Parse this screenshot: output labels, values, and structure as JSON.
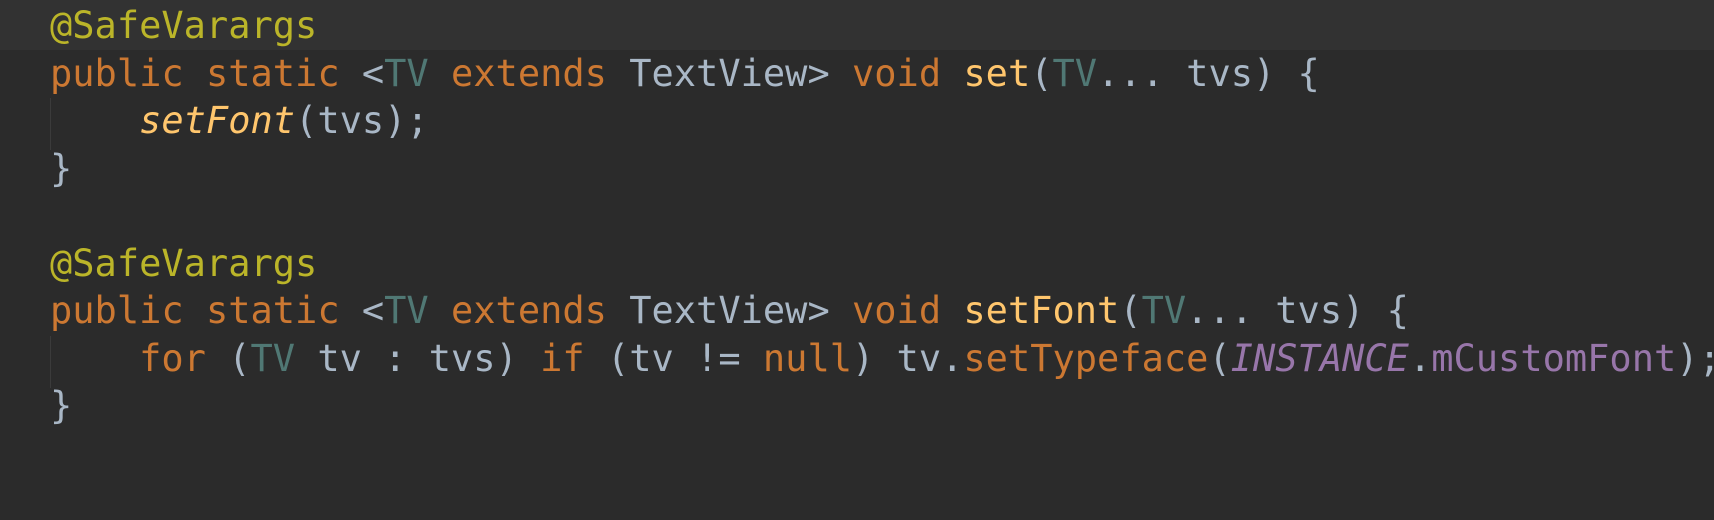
{
  "editor": {
    "language": "java",
    "theme_colors": {
      "background": "#2b2b2b",
      "current_line": "#323232",
      "annotation": "#bbb529",
      "keyword": "#cc7832",
      "type_param": "#507874",
      "plain": "#a9b7c6",
      "method": "#ffc66d",
      "static_field": "#9876aa"
    },
    "lines": [
      {
        "tokens": [
          {
            "t": "@SafeVarargs",
            "k": "ann"
          }
        ]
      },
      {
        "tokens": [
          {
            "t": "public",
            "k": "kw"
          },
          {
            "t": " ",
            "k": "pl"
          },
          {
            "t": "static",
            "k": "kw"
          },
          {
            "t": " <",
            "k": "pl"
          },
          {
            "t": "TV",
            "k": "tp"
          },
          {
            "t": " ",
            "k": "pl"
          },
          {
            "t": "extends",
            "k": "kw"
          },
          {
            "t": " ",
            "k": "pl"
          },
          {
            "t": "TextView",
            "k": "cls"
          },
          {
            "t": "> ",
            "k": "pl"
          },
          {
            "t": "void",
            "k": "kw"
          },
          {
            "t": " ",
            "k": "pl"
          },
          {
            "t": "set",
            "k": "fn"
          },
          {
            "t": "(",
            "k": "pl"
          },
          {
            "t": "TV",
            "k": "tp"
          },
          {
            "t": "... tvs) {",
            "k": "pl"
          }
        ]
      },
      {
        "tokens": [
          {
            "t": "    ",
            "k": "pl"
          },
          {
            "t": "setFont",
            "k": "fn-i"
          },
          {
            "t": "(tvs);",
            "k": "pl"
          }
        ]
      },
      {
        "tokens": [
          {
            "t": "}",
            "k": "pl"
          }
        ]
      },
      {
        "tokens": []
      },
      {
        "tokens": [
          {
            "t": "@SafeVarargs",
            "k": "ann"
          }
        ]
      },
      {
        "tokens": [
          {
            "t": "public",
            "k": "kw"
          },
          {
            "t": " ",
            "k": "pl"
          },
          {
            "t": "static",
            "k": "kw"
          },
          {
            "t": " <",
            "k": "pl"
          },
          {
            "t": "TV",
            "k": "tp"
          },
          {
            "t": " ",
            "k": "pl"
          },
          {
            "t": "extends",
            "k": "kw"
          },
          {
            "t": " ",
            "k": "pl"
          },
          {
            "t": "TextView",
            "k": "cls"
          },
          {
            "t": "> ",
            "k": "pl"
          },
          {
            "t": "void",
            "k": "kw"
          },
          {
            "t": " ",
            "k": "pl"
          },
          {
            "t": "setFont",
            "k": "fn"
          },
          {
            "t": "(",
            "k": "pl"
          },
          {
            "t": "TV",
            "k": "tp"
          },
          {
            "t": "... tvs) {",
            "k": "pl"
          }
        ]
      },
      {
        "tokens": [
          {
            "t": "    ",
            "k": "pl"
          },
          {
            "t": "for",
            "k": "kw"
          },
          {
            "t": " (",
            "k": "pl"
          },
          {
            "t": "TV",
            "k": "tp"
          },
          {
            "t": " tv : tvs) ",
            "k": "pl"
          },
          {
            "t": "if",
            "k": "kw"
          },
          {
            "t": " (tv != ",
            "k": "pl"
          },
          {
            "t": "null",
            "k": "kw"
          },
          {
            "t": ") tv.",
            "k": "pl"
          },
          {
            "t": "setTypeface",
            "k": "kw"
          },
          {
            "t": "(",
            "k": "pl"
          },
          {
            "t": "INSTANCE",
            "k": "sta"
          },
          {
            "t": ".",
            "k": "pl"
          },
          {
            "t": "mCustomFont",
            "k": "fld"
          },
          {
            "t": ");",
            "k": "pl"
          }
        ]
      },
      {
        "tokens": [
          {
            "t": "}",
            "k": "pl"
          }
        ]
      }
    ]
  }
}
